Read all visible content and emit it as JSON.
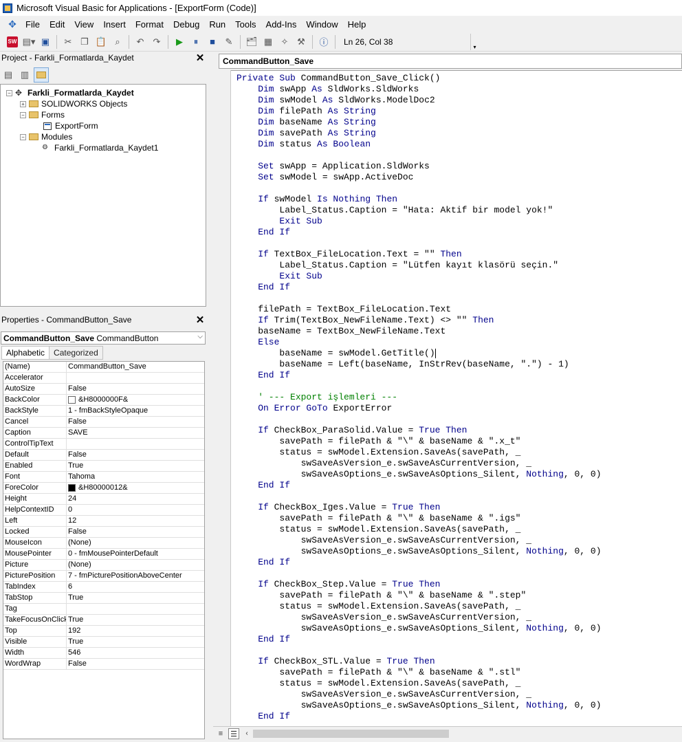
{
  "window": {
    "title": "Microsoft Visual Basic for Applications - [ExportForm (Code)]"
  },
  "menu": [
    "File",
    "Edit",
    "View",
    "Insert",
    "Format",
    "Debug",
    "Run",
    "Tools",
    "Add-Ins",
    "Window",
    "Help"
  ],
  "toolbar": {
    "cursor_position": "Ln 26, Col 38"
  },
  "project": {
    "header": "Project - Farkli_Formatlarda_Kaydet",
    "root": "Farkli_Formatlarda_Kaydet",
    "solidworks_objects": "SOLIDWORKS Objects",
    "forms_folder": "Forms",
    "form_item": "ExportForm",
    "modules_folder": "Modules",
    "module_item": "Farkli_Formatlarda_Kaydet1"
  },
  "properties": {
    "header": "Properties - CommandButton_Save",
    "object_name": "CommandButton_Save",
    "object_type": "CommandButton",
    "tab_alphabetic": "Alphabetic",
    "tab_categorized": "Categorized",
    "rows": [
      {
        "name": "(Name)",
        "value": "CommandButton_Save"
      },
      {
        "name": "Accelerator",
        "value": ""
      },
      {
        "name": "AutoSize",
        "value": "False"
      },
      {
        "name": "BackColor",
        "value": "&H8000000F&",
        "swatch": "#ffffff"
      },
      {
        "name": "BackStyle",
        "value": "1 - fmBackStyleOpaque"
      },
      {
        "name": "Cancel",
        "value": "False"
      },
      {
        "name": "Caption",
        "value": "SAVE"
      },
      {
        "name": "ControlTipText",
        "value": ""
      },
      {
        "name": "Default",
        "value": "False"
      },
      {
        "name": "Enabled",
        "value": "True"
      },
      {
        "name": "Font",
        "value": "Tahoma"
      },
      {
        "name": "ForeColor",
        "value": "&H80000012&",
        "swatch": "#000000"
      },
      {
        "name": "Height",
        "value": "24"
      },
      {
        "name": "HelpContextID",
        "value": "0"
      },
      {
        "name": "Left",
        "value": "12"
      },
      {
        "name": "Locked",
        "value": "False"
      },
      {
        "name": "MouseIcon",
        "value": "(None)"
      },
      {
        "name": "MousePointer",
        "value": "0 - fmMousePointerDefault"
      },
      {
        "name": "Picture",
        "value": "(None)"
      },
      {
        "name": "PicturePosition",
        "value": "7 - fmPicturePositionAboveCenter"
      },
      {
        "name": "TabIndex",
        "value": "6"
      },
      {
        "name": "TabStop",
        "value": "True"
      },
      {
        "name": "Tag",
        "value": ""
      },
      {
        "name": "TakeFocusOnClick",
        "value": "True"
      },
      {
        "name": "Top",
        "value": "192"
      },
      {
        "name": "Visible",
        "value": "True"
      },
      {
        "name": "Width",
        "value": "546"
      },
      {
        "name": "WordWrap",
        "value": "False"
      }
    ]
  },
  "code": {
    "procedure": "CommandButton_Save",
    "lines": [
      [
        [
          "kw",
          "Private Sub "
        ],
        [
          "tx",
          "CommandButton_Save_Click()"
        ]
      ],
      [
        [
          "kw",
          "    Dim "
        ],
        [
          "tx",
          "swApp "
        ],
        [
          "kw",
          "As "
        ],
        [
          "tx",
          "SldWorks.SldWorks"
        ]
      ],
      [
        [
          "kw",
          "    Dim "
        ],
        [
          "tx",
          "swModel "
        ],
        [
          "kw",
          "As "
        ],
        [
          "tx",
          "SldWorks.ModelDoc2"
        ]
      ],
      [
        [
          "kw",
          "    Dim "
        ],
        [
          "tx",
          "filePath "
        ],
        [
          "kw",
          "As String"
        ]
      ],
      [
        [
          "kw",
          "    Dim "
        ],
        [
          "tx",
          "baseName "
        ],
        [
          "kw",
          "As String"
        ]
      ],
      [
        [
          "kw",
          "    Dim "
        ],
        [
          "tx",
          "savePath "
        ],
        [
          "kw",
          "As String"
        ]
      ],
      [
        [
          "kw",
          "    Dim "
        ],
        [
          "tx",
          "status "
        ],
        [
          "kw",
          "As Boolean"
        ]
      ],
      [],
      [
        [
          "kw",
          "    Set "
        ],
        [
          "tx",
          "swApp = Application.SldWorks"
        ]
      ],
      [
        [
          "kw",
          "    Set "
        ],
        [
          "tx",
          "swModel = swApp.ActiveDoc"
        ]
      ],
      [],
      [
        [
          "kw",
          "    If "
        ],
        [
          "tx",
          "swModel "
        ],
        [
          "kw",
          "Is Nothing Then"
        ]
      ],
      [
        [
          "tx",
          "        Label_Status.Caption = \"Hata: Aktif bir model yok!\""
        ]
      ],
      [
        [
          "kw",
          "        Exit Sub"
        ]
      ],
      [
        [
          "kw",
          "    End If"
        ]
      ],
      [],
      [
        [
          "kw",
          "    If "
        ],
        [
          "tx",
          "TextBox_FileLocation.Text = \"\" "
        ],
        [
          "kw",
          "Then"
        ]
      ],
      [
        [
          "tx",
          "        Label_Status.Caption = \"Lütfen kayıt klasörü seçin.\""
        ]
      ],
      [
        [
          "kw",
          "        Exit Sub"
        ]
      ],
      [
        [
          "kw",
          "    End If"
        ]
      ],
      [],
      [
        [
          "tx",
          "    filePath = TextBox_FileLocation.Text"
        ]
      ],
      [
        [
          "kw",
          "    If "
        ],
        [
          "tx",
          "Trim(TextBox_NewFileName.Text) <> \"\" "
        ],
        [
          "kw",
          "Then"
        ]
      ],
      [
        [
          "tx",
          "    baseName = TextBox_NewFileName.Text"
        ]
      ],
      [
        [
          "kw",
          "    Else"
        ]
      ],
      [
        [
          "tx",
          "        baseName = swModel.GetTitle()"
        ]
      ],
      [
        [
          "tx",
          "        baseName = Left(baseName, InStrRev(baseName, \".\") - 1)"
        ]
      ],
      [
        [
          "kw",
          "    End If"
        ]
      ],
      [],
      [
        [
          "cm",
          "    ' --- Export işlemleri ---"
        ]
      ],
      [
        [
          "kw",
          "    On Error GoTo "
        ],
        [
          "tx",
          "ExportError"
        ]
      ],
      [],
      [
        [
          "kw",
          "    If "
        ],
        [
          "tx",
          "CheckBox_ParaSolid.Value = "
        ],
        [
          "kw",
          "True Then"
        ]
      ],
      [
        [
          "tx",
          "        savePath = filePath & \"\\\" & baseName & \".x_t\""
        ]
      ],
      [
        [
          "tx",
          "        status = swModel.Extension.SaveAs(savePath, _"
        ]
      ],
      [
        [
          "tx",
          "            swSaveAsVersion_e.swSaveAsCurrentVersion, _"
        ]
      ],
      [
        [
          "tx",
          "            swSaveAsOptions_e.swSaveAsOptions_Silent, "
        ],
        [
          "kw",
          "Nothing"
        ],
        [
          "tx",
          ", 0, 0)"
        ]
      ],
      [
        [
          "kw",
          "    End If"
        ]
      ],
      [],
      [
        [
          "kw",
          "    If "
        ],
        [
          "tx",
          "CheckBox_Iges.Value = "
        ],
        [
          "kw",
          "True Then"
        ]
      ],
      [
        [
          "tx",
          "        savePath = filePath & \"\\\" & baseName & \".igs\""
        ]
      ],
      [
        [
          "tx",
          "        status = swModel.Extension.SaveAs(savePath, _"
        ]
      ],
      [
        [
          "tx",
          "            swSaveAsVersion_e.swSaveAsCurrentVersion, _"
        ]
      ],
      [
        [
          "tx",
          "            swSaveAsOptions_e.swSaveAsOptions_Silent, "
        ],
        [
          "kw",
          "Nothing"
        ],
        [
          "tx",
          ", 0, 0)"
        ]
      ],
      [
        [
          "kw",
          "    End If"
        ]
      ],
      [],
      [
        [
          "kw",
          "    If "
        ],
        [
          "tx",
          "CheckBox_Step.Value = "
        ],
        [
          "kw",
          "True Then"
        ]
      ],
      [
        [
          "tx",
          "        savePath = filePath & \"\\\" & baseName & \".step\""
        ]
      ],
      [
        [
          "tx",
          "        status = swModel.Extension.SaveAs(savePath, _"
        ]
      ],
      [
        [
          "tx",
          "            swSaveAsVersion_e.swSaveAsCurrentVersion, _"
        ]
      ],
      [
        [
          "tx",
          "            swSaveAsOptions_e.swSaveAsOptions_Silent, "
        ],
        [
          "kw",
          "Nothing"
        ],
        [
          "tx",
          ", 0, 0)"
        ]
      ],
      [
        [
          "kw",
          "    End If"
        ]
      ],
      [],
      [
        [
          "kw",
          "    If "
        ],
        [
          "tx",
          "CheckBox_STL.Value = "
        ],
        [
          "kw",
          "True Then"
        ]
      ],
      [
        [
          "tx",
          "        savePath = filePath & \"\\\" & baseName & \".stl\""
        ]
      ],
      [
        [
          "tx",
          "        status = swModel.Extension.SaveAs(savePath, _"
        ]
      ],
      [
        [
          "tx",
          "            swSaveAsVersion_e.swSaveAsCurrentVersion, _"
        ]
      ],
      [
        [
          "tx",
          "            swSaveAsOptions_e.swSaveAsOptions_Silent, "
        ],
        [
          "kw",
          "Nothing"
        ],
        [
          "tx",
          ", 0, 0)"
        ]
      ],
      [
        [
          "kw",
          "    End If"
        ]
      ]
    ]
  }
}
